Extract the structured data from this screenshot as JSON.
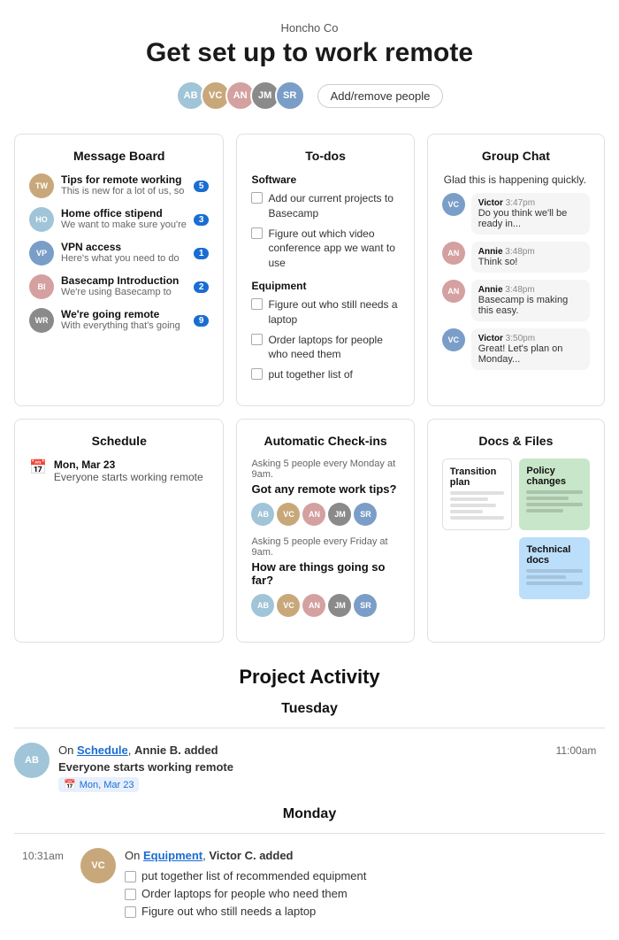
{
  "header": {
    "company": "Honcho Co",
    "title": "Get set up to work remote",
    "add_people_label": "Add/remove people"
  },
  "avatars": [
    {
      "id": "a1",
      "color": "#a0c4d8",
      "initials": "AB"
    },
    {
      "id": "a2",
      "color": "#c8a87a",
      "initials": "VC"
    },
    {
      "id": "a3",
      "color": "#d4a0a0",
      "initials": "AN"
    },
    {
      "id": "a4",
      "color": "#8a8a8a",
      "initials": "JM"
    },
    {
      "id": "a5",
      "color": "#7a9ec8",
      "initials": "SR"
    }
  ],
  "message_board": {
    "title": "Message Board",
    "items": [
      {
        "title": "Tips for remote working",
        "sub": "This is new for a lot of us, so",
        "badge": "5",
        "color": "#c8a87a"
      },
      {
        "title": "Home office stipend",
        "sub": "We want to make sure you're",
        "badge": "3",
        "color": "#a0c4d8"
      },
      {
        "title": "VPN access",
        "sub": "Here's what you need to do",
        "badge": "1",
        "color": "#7a9ec8"
      },
      {
        "title": "Basecamp Introduction",
        "sub": "We're using Basecamp to",
        "badge": "2",
        "color": "#d4a0a0"
      },
      {
        "title": "We're going remote",
        "sub": "With everything that's going",
        "badge": "9",
        "color": "#8a8a8a"
      }
    ]
  },
  "todos": {
    "title": "To-dos",
    "sections": [
      {
        "title": "Software",
        "items": [
          "Add our current projects to Basecamp",
          "Figure out which video conference app we want to use"
        ]
      },
      {
        "title": "Equipment",
        "items": [
          "Figure out who still needs a laptop",
          "Order laptops for people who need them",
          "put together list of"
        ]
      }
    ]
  },
  "group_chat": {
    "title": "Group Chat",
    "intro": "Glad this is happening quickly.",
    "messages": [
      {
        "name": "Victor",
        "time": "3:47pm",
        "text": "Do you think we'll be ready in...",
        "color": "#7a9ec8",
        "initials": "VC"
      },
      {
        "name": "Annie",
        "time": "3:48pm",
        "text": "Think so!",
        "color": "#d4a0a0",
        "initials": "AN"
      },
      {
        "name": "Annie",
        "time": "3:48pm",
        "text": "Basecamp is making this easy.",
        "color": "#d4a0a0",
        "initials": "AN"
      },
      {
        "name": "Victor",
        "time": "3:50pm",
        "text": "Great! Let's plan on Monday...",
        "color": "#7a9ec8",
        "initials": "VC"
      }
    ]
  },
  "schedule": {
    "title": "Schedule",
    "items": [
      {
        "date": "Mon, Mar 23",
        "desc": "Everyone starts working remote"
      }
    ]
  },
  "checkins": {
    "title": "Automatic Check-ins",
    "items": [
      {
        "asking": "Asking 5 people every Monday at 9am.",
        "question": "Got any remote work tips?",
        "avatars": [
          {
            "color": "#a0c4d8",
            "initials": "AB"
          },
          {
            "color": "#c8a87a",
            "initials": "VC"
          },
          {
            "color": "#d4a0a0",
            "initials": "AN"
          },
          {
            "color": "#8a8a8a",
            "initials": "JM"
          },
          {
            "color": "#7a9ec8",
            "initials": "SR"
          }
        ]
      },
      {
        "asking": "Asking 5 people every Friday at 9am.",
        "question": "How are things going so far?",
        "avatars": [
          {
            "color": "#a0c4d8",
            "initials": "AB"
          },
          {
            "color": "#c8a87a",
            "initials": "VC"
          },
          {
            "color": "#d4a0a0",
            "initials": "AN"
          },
          {
            "color": "#8a8a8a",
            "initials": "JM"
          },
          {
            "color": "#7a9ec8",
            "initials": "SR"
          }
        ]
      }
    ]
  },
  "docs": {
    "title": "Docs & Files",
    "items": [
      {
        "title": "Transition plan",
        "style": "white"
      },
      {
        "title": "Policy changes",
        "style": "green"
      },
      {
        "title": "Technical docs",
        "style": "blue"
      }
    ]
  },
  "project_activity": {
    "title": "Project Activity",
    "days": [
      {
        "label": "Tuesday",
        "events": [
          {
            "time": "11:00am",
            "side": "left",
            "avatar_color": "#a0c4d8",
            "avatar_initials": "AB",
            "action_prefix": "On",
            "link": "Schedule",
            "action_suffix": ", Annie B. added",
            "item_title": "Everyone starts working remote",
            "date_badge": "Mon, Mar 23"
          }
        ]
      },
      {
        "label": "Monday",
        "events": [
          {
            "time": "10:31am",
            "side": "right",
            "avatar_color": "#c8a87a",
            "avatar_initials": "VC",
            "action_prefix": "On",
            "link": "Equipment",
            "action_suffix": ", Victor C. added",
            "todos": [
              "put together list of recommended equipment",
              "Order laptops for people who need them",
              "Figure out who still needs a laptop"
            ]
          }
        ]
      }
    ]
  }
}
